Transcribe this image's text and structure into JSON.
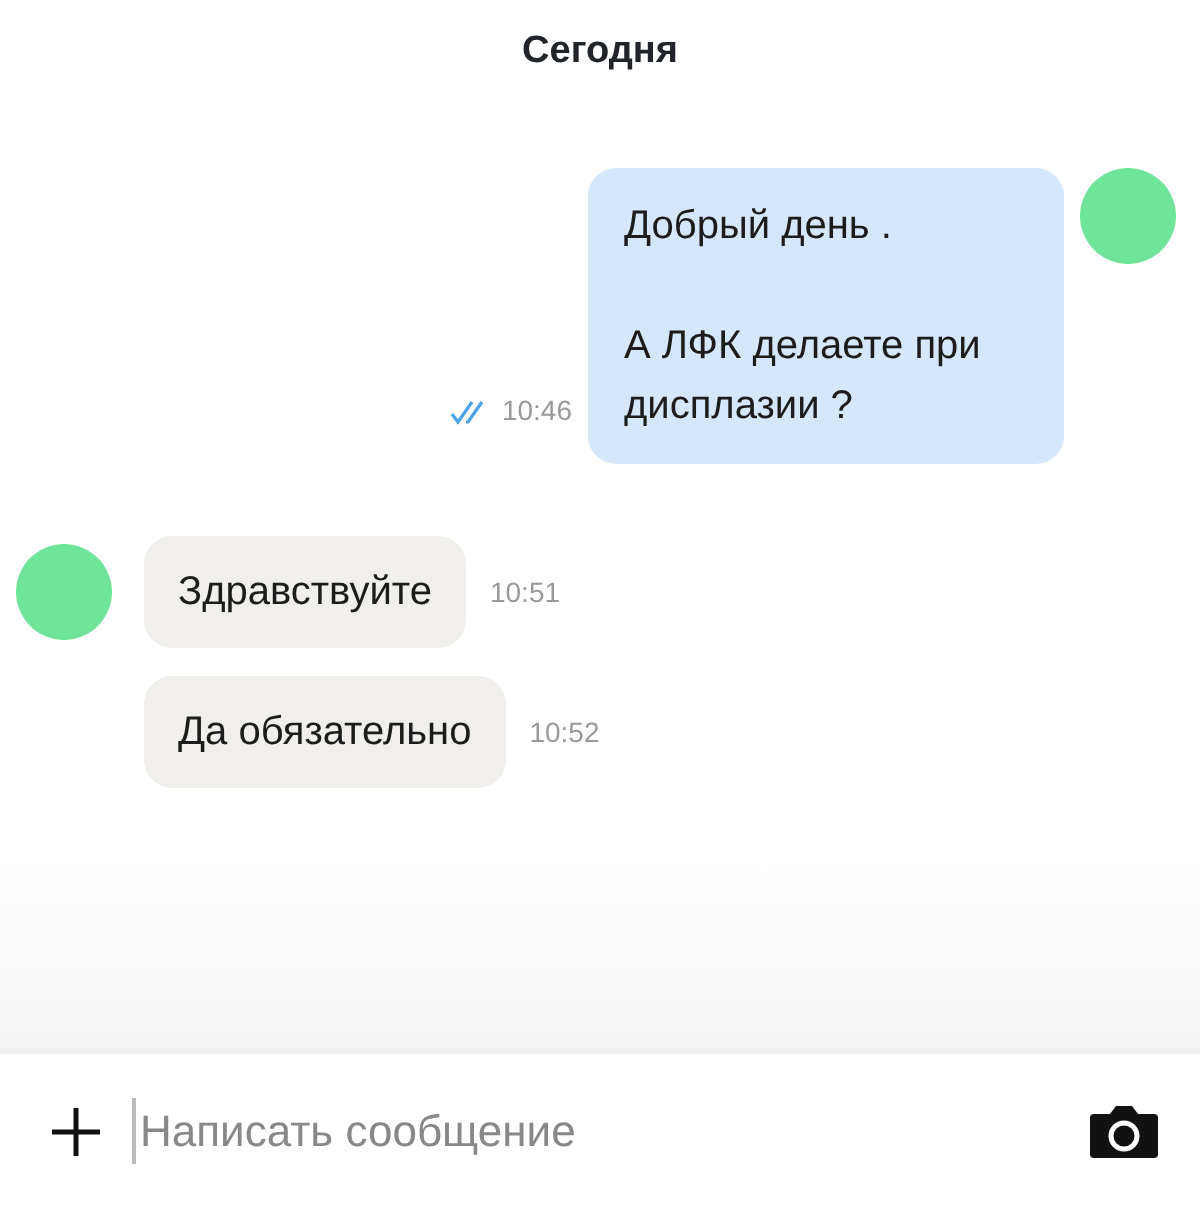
{
  "header": {
    "title": "Сегодня"
  },
  "messages": [
    {
      "kind": "outgoing",
      "text": "Добрый день .\n\nА ЛФК делаете при дисплазии ?",
      "time": "10:46",
      "read": true,
      "avatar": true
    },
    {
      "kind": "incoming",
      "text": "Здравствуйте",
      "time": "10:51",
      "avatar": true
    },
    {
      "kind": "incoming",
      "text": "Да обязательно",
      "time": "10:52",
      "avatar": false
    }
  ],
  "composer": {
    "placeholder": "Написать сообщение"
  }
}
